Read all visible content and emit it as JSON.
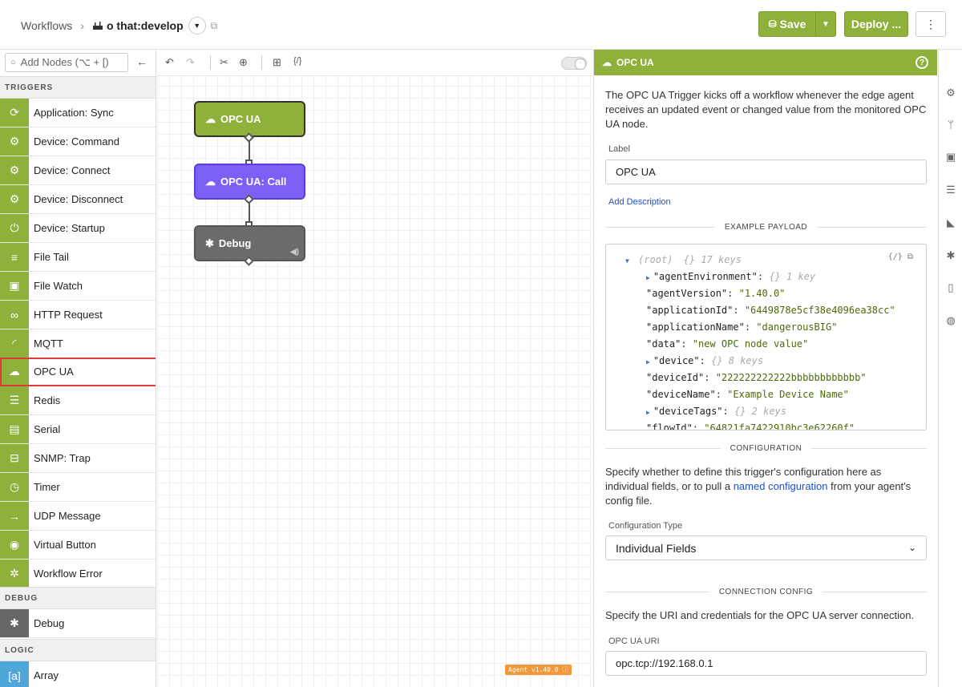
{
  "header": {
    "breadcrumb_root": "Workflows",
    "workflow_name": "o that:develop",
    "save_label": "Save",
    "deploy_label": "Deploy ..."
  },
  "sidebar": {
    "search_placeholder": "Add Nodes (⌥ + [)",
    "sections": {
      "triggers": "TRIGGERS",
      "debug": "DEBUG",
      "logic": "LOGIC"
    },
    "triggers": [
      {
        "label": "Application: Sync",
        "icon": "sync-icon"
      },
      {
        "label": "Device: Command",
        "icon": "chip-icon"
      },
      {
        "label": "Device: Connect",
        "icon": "chip-icon"
      },
      {
        "label": "Device: Disconnect",
        "icon": "chip-icon"
      },
      {
        "label": "Device: Startup",
        "icon": "power-icon"
      },
      {
        "label": "File Tail",
        "icon": "lines-icon"
      },
      {
        "label": "File Watch",
        "icon": "folder-plus-icon"
      },
      {
        "label": "HTTP Request",
        "icon": "link-icon"
      },
      {
        "label": "MQTT",
        "icon": "rss-icon"
      },
      {
        "label": "OPC UA",
        "icon": "cloud-upload-icon"
      },
      {
        "label": "Redis",
        "icon": "stack-icon"
      },
      {
        "label": "Serial",
        "icon": "serial-icon"
      },
      {
        "label": "SNMP: Trap",
        "icon": "network-icon"
      },
      {
        "label": "Timer",
        "icon": "stopwatch-icon"
      },
      {
        "label": "UDP Message",
        "icon": "arrow-right-icon"
      },
      {
        "label": "Virtual Button",
        "icon": "radio-button-icon"
      },
      {
        "label": "Workflow Error",
        "icon": "error-gear-icon"
      }
    ],
    "debug_items": [
      {
        "label": "Debug",
        "icon": "bug-icon"
      }
    ],
    "logic_items": [
      {
        "label": "Array",
        "icon": "brackets-icon"
      }
    ]
  },
  "canvas": {
    "nodes": [
      {
        "label": "OPC UA",
        "color": "#8fb03b"
      },
      {
        "label": "OPC UA: Call",
        "color": "#7d5ff5"
      },
      {
        "label": "Debug",
        "color": "#6b6b6b"
      }
    ],
    "agent_badge": "Agent v1.40.0 ⓘ"
  },
  "panel": {
    "title": "OPC UA",
    "description": "The OPC UA Trigger kicks off a workflow whenever the edge agent receives an updated event or changed value from the monitored OPC UA node.",
    "label_field_label": "Label",
    "label_field_value": "OPC UA",
    "add_description": "Add Description",
    "example_payload_title": "EXAMPLE PAYLOAD",
    "payload": {
      "root": "(root)",
      "root_meta": "{} 17 keys",
      "rows": [
        {
          "key": "\"agentEnvironment\"",
          "meta": "{} 1 key",
          "collapsible": true
        },
        {
          "key": "\"agentVersion\"",
          "value": "\"1.40.0\""
        },
        {
          "key": "\"applicationId\"",
          "value": "\"6449878e5cf38e4096ea38cc\""
        },
        {
          "key": "\"applicationName\"",
          "value": "\"dangerousBIG\""
        },
        {
          "key": "\"data\"",
          "value": "\"new OPC node value\""
        },
        {
          "key": "\"device\"",
          "meta": "{} 8 keys",
          "collapsible": true
        },
        {
          "key": "\"deviceId\"",
          "value": "\"222222222222bbbbbbbbbbbb\""
        },
        {
          "key": "\"deviceName\"",
          "value": "\"Example Device Name\""
        },
        {
          "key": "\"deviceTags\"",
          "meta": "{} 2 keys",
          "collapsible": true
        },
        {
          "key": "\"flowId\"",
          "value": "\"64821fa7422910bc3e62260f\""
        }
      ]
    },
    "configuration_title": "CONFIGURATION",
    "configuration_text_1": "Specify whether to define this trigger's configuration here as individual fields, or to pull a ",
    "configuration_link": "named configuration",
    "configuration_text_2": " from your agent's config file.",
    "configuration_type_label": "Configuration Type",
    "configuration_type_value": "Individual Fields",
    "connection_config_title": "CONNECTION CONFIG",
    "connection_text": "Specify the URI and credentials for the OPC UA server connection.",
    "opc_uri_label": "OPC UA URI",
    "opc_uri_value": "opc.tcp://192.168.0.1"
  }
}
